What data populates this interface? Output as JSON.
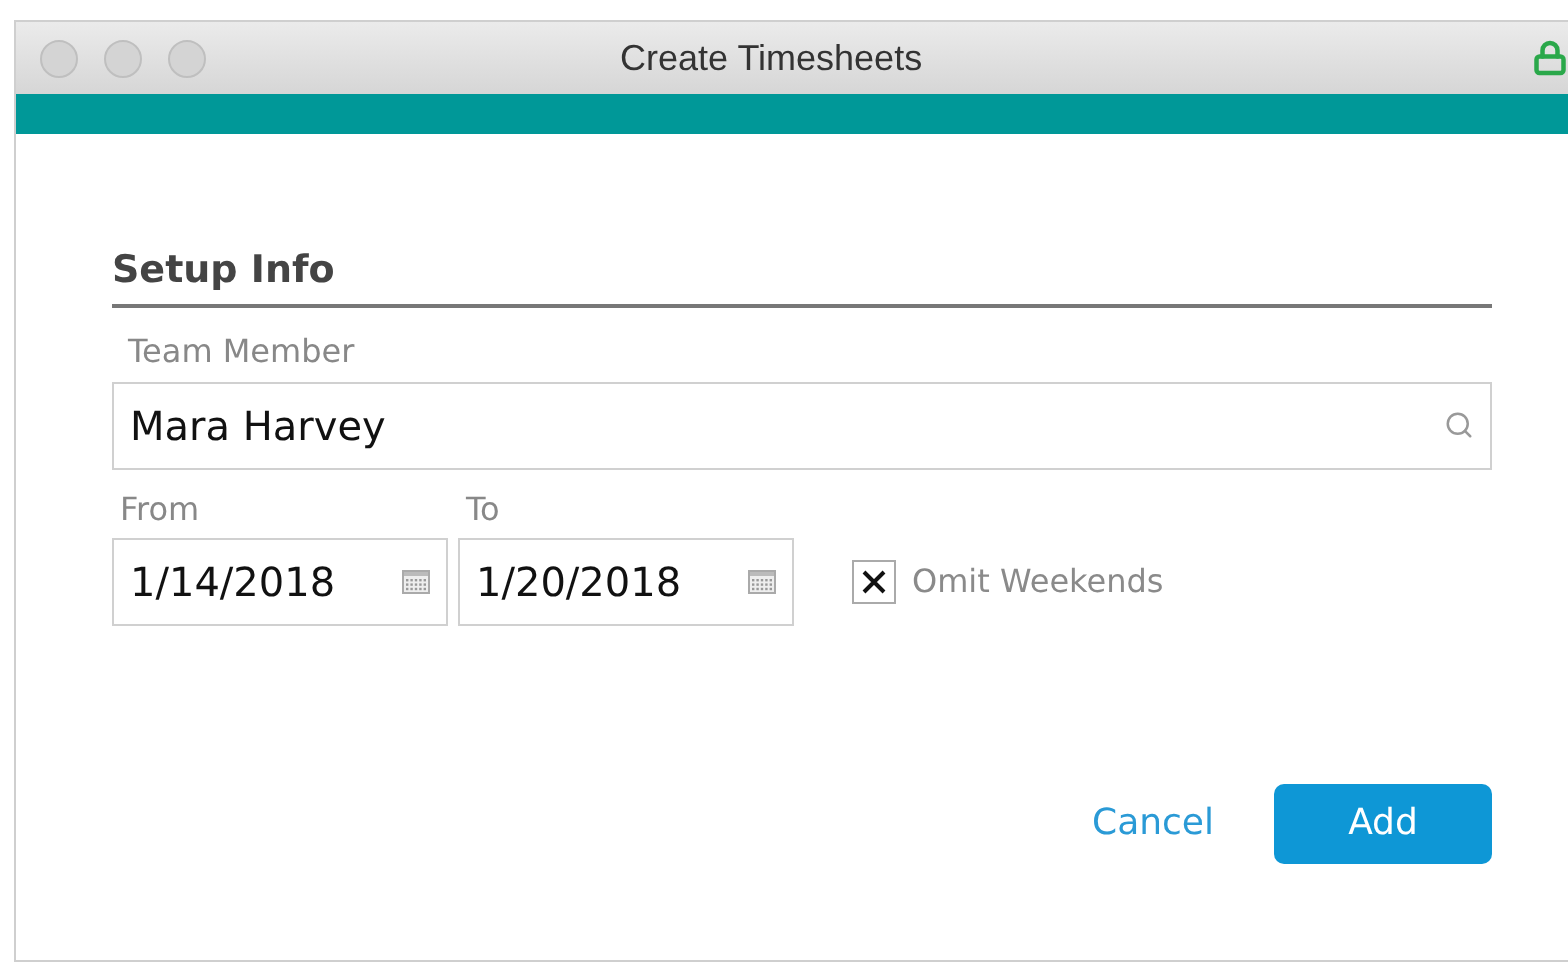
{
  "window": {
    "title": "Create Timesheets"
  },
  "section": {
    "title": "Setup Info"
  },
  "team_member": {
    "label": "Team Member",
    "value": "Mara Harvey"
  },
  "from": {
    "label": "From",
    "value": "1/14/2018"
  },
  "to": {
    "label": "To",
    "value": "1/20/2018"
  },
  "omit_weekends": {
    "label": "Omit Weekends",
    "checked": true
  },
  "buttons": [
    {
      "kind": "link",
      "label": "Cancel"
    },
    {
      "kind": "primary",
      "label": "Add"
    }
  ]
}
